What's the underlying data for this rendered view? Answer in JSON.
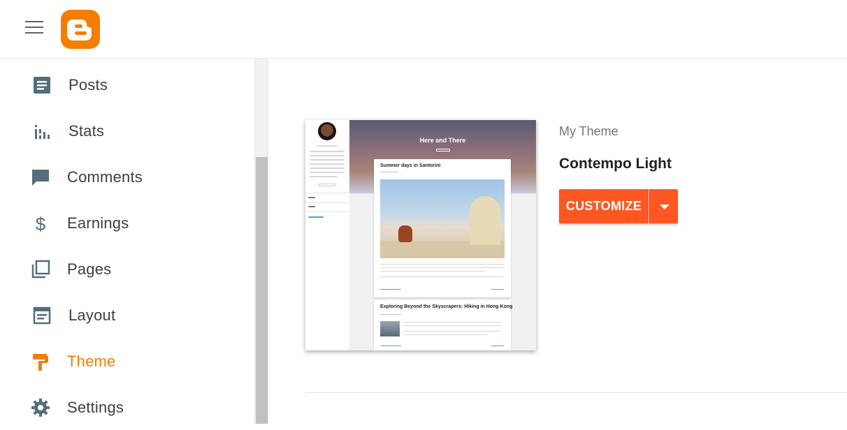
{
  "app": {
    "name": "Blogger"
  },
  "colors": {
    "accent": "#f57d00",
    "button": "#ff5722",
    "icon": "#546e7a"
  },
  "header": {
    "menu_icon": "hamburger-menu-icon",
    "logo_icon": "blogger-logo-icon"
  },
  "sidebar": {
    "items": [
      {
        "label": "Posts",
        "icon": "posts-icon"
      },
      {
        "label": "Stats",
        "icon": "stats-icon"
      },
      {
        "label": "Comments",
        "icon": "comments-icon"
      },
      {
        "label": "Earnings",
        "icon": "dollar-icon"
      },
      {
        "label": "Pages",
        "icon": "pages-icon"
      },
      {
        "label": "Layout",
        "icon": "layout-icon"
      },
      {
        "label": "Theme",
        "icon": "theme-roller-icon",
        "active": true
      },
      {
        "label": "Settings",
        "icon": "gear-icon"
      }
    ]
  },
  "theme": {
    "section_label": "My Theme",
    "name": "Contempo Light",
    "customize_label": "CUSTOMIZE",
    "preview": {
      "blog_title": "Here and There",
      "post1_title": "Summer days in Santorini",
      "post2_title": "Exploring Beyond the Skyscrapers: Hiking in Hong Kong"
    }
  }
}
